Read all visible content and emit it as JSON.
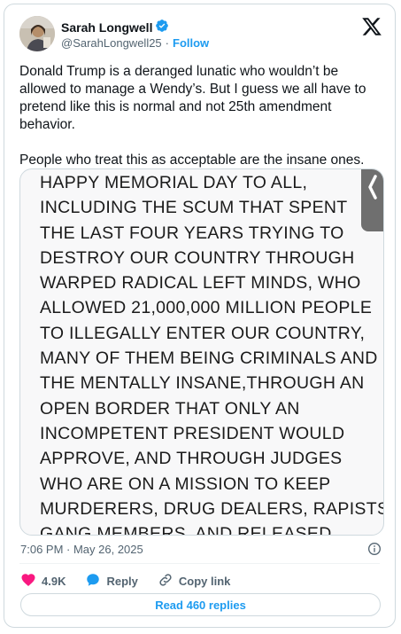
{
  "author": {
    "name": "Sarah Longwell",
    "handle": "@SarahLongwell25",
    "separator": "·",
    "follow_label": "Follow"
  },
  "tweet": {
    "paragraphs": [
      "Donald Trump is a deranged lunatic who wouldn’t be allowed to manage a Wendy’s. But I guess we all have to pretend like this is normal and not 25th amendment behavior.",
      "People who treat this as acceptable are the insane ones."
    ]
  },
  "media": {
    "text": "HAPPY MEMORIAL DAY TO ALL,\nINCLUDING THE SCUM THAT SPENT\nTHE LAST FOUR YEARS TRYING TO\nDESTROY OUR COUNTRY THROUGH\nWARPED RADICAL LEFT MINDS, WHO\nALLOWED 21,000,000 MILLION PEOPLE\nTO ILLEGALLY ENTER OUR COUNTRY,\nMANY OF THEM BEING CRIMINALS AND\nTHE MENTALLY INSANE,THROUGH AN\nOPEN BORDER THAT ONLY AN\nINCOMPETENT PRESIDENT WOULD\nAPPROVE, AND THROUGH JUDGES\nWHO ARE ON A MISSION TO KEEP\nMURDERERS, DRUG DEALERS, RAPISTS,\nGANG MEMBERS, AND RELEASED",
    "tab_glyph": "❮"
  },
  "meta": {
    "timestamp": "7:06 PM · May 26, 2025"
  },
  "actions": {
    "like_count": "4.9K",
    "reply_label": "Reply",
    "copy_link_label": "Copy link"
  },
  "read_replies_label": "Read 460 replies",
  "colors": {
    "accent": "#1d9bf0",
    "like": "#f91880",
    "muted": "#536471",
    "border": "#cfd9de"
  },
  "icons": [
    "verified-badge-icon",
    "x-logo-icon",
    "info-icon",
    "heart-icon",
    "reply-icon",
    "link-icon"
  ]
}
